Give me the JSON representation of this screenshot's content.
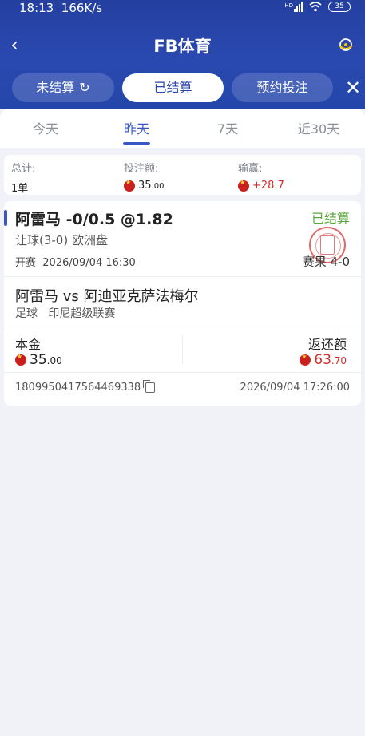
{
  "status": {
    "time": "18:13",
    "speed": "166K/s",
    "hd": "HD",
    "battery": "35"
  },
  "header": {
    "title": "FB体育"
  },
  "segments": [
    {
      "label": "未结算"
    },
    {
      "label": "已结算"
    },
    {
      "label": "预约投注"
    }
  ],
  "tabs": [
    {
      "label": "今天"
    },
    {
      "label": "昨天"
    },
    {
      "label": "7天"
    },
    {
      "label": "近30天"
    }
  ],
  "summary": {
    "total_label": "总计:",
    "total_value": "1单",
    "stake_label": "投注额:",
    "stake_int": "35",
    "stake_dec": ".00",
    "winloss_label": "输赢:",
    "winloss_value": "+28.7"
  },
  "bet": {
    "title": "阿雷马 -0/0.5 @1.82",
    "status": "已结算",
    "market": "让球(3-0) 欧洲盘",
    "start_label": "开赛",
    "start_time": "2026/09/04 16:30",
    "result_label": "赛果",
    "result_score": "4-0",
    "match": "阿雷马 vs 阿迪亚克萨法梅尔",
    "sport": "足球",
    "league": "印尼超级联赛",
    "stake_label": "本金",
    "stake_int": "35",
    "stake_dec": ".00",
    "return_label": "返还额",
    "return_int": "63",
    "return_dec": ".70",
    "order_id": "1809950417564469338",
    "order_time": "2026/09/04 17:26:00"
  },
  "colors": {
    "brand": "#2a47ad",
    "settled": "#5aa83c",
    "win": "#d72a2a"
  },
  "icons": [
    "back-arrow-icon",
    "support-headset-icon",
    "refresh-icon",
    "close-icon",
    "coin-icon",
    "copy-icon",
    "settled-stamp-icon"
  ]
}
